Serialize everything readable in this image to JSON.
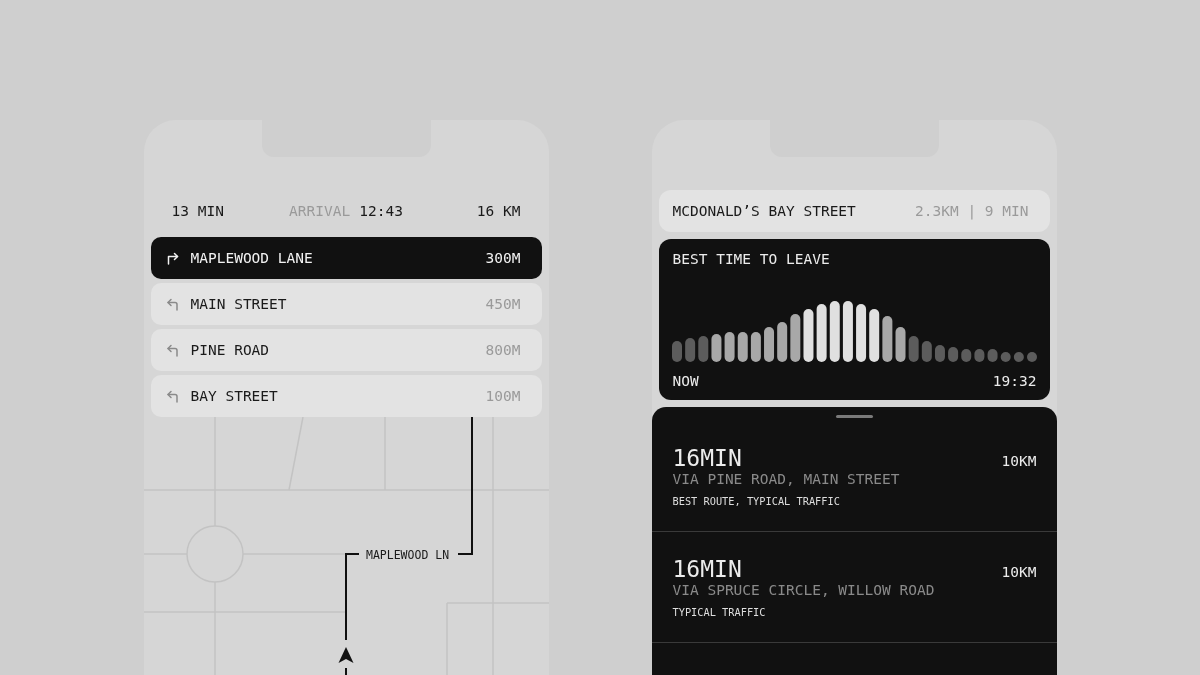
{
  "navigation": {
    "duration": "13 MIN",
    "arrival_label": "ARRIVAL",
    "arrival_time": "12:43",
    "distance": "16 KM"
  },
  "steps": [
    {
      "kind": "right",
      "street": "MAPLEWOOD LANE",
      "distance": "300M",
      "current": true
    },
    {
      "kind": "left",
      "street": "MAIN STREET",
      "distance": "450M",
      "current": false
    },
    {
      "kind": "left",
      "street": "PINE ROAD",
      "distance": "800M",
      "current": false
    },
    {
      "kind": "left",
      "street": "BAY STREET",
      "distance": "100M",
      "current": false
    }
  ],
  "map": {
    "street_label": "MAPLEWOOD LN"
  },
  "destination": {
    "name": "MCDONALD’S BAY STREET",
    "summary": "2.3KM | 9 MIN"
  },
  "departure": {
    "title": "BEST TIME TO LEAVE",
    "start_label": "NOW",
    "end_label": "19:32"
  },
  "routes": [
    {
      "duration": "16MIN",
      "distance": "10KM",
      "via": "VIA PINE ROAD, MAIN STREET",
      "note": "BEST ROUTE, TYPICAL TRAFFIC"
    },
    {
      "duration": "16MIN",
      "distance": "10KM",
      "via": "VIA SPRUCE CIRCLE, WILLOW ROAD",
      "note": "TYPICAL TRAFFIC"
    }
  ]
}
